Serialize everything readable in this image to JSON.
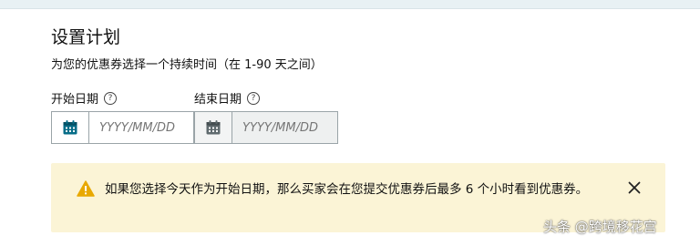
{
  "header": {
    "title": "设置计划",
    "subtitle": "为您的优惠券选择一个持续时间（在 1-90 天之间）"
  },
  "start_date": {
    "label": "开始日期",
    "placeholder": "YYYY/MM/DD",
    "value": ""
  },
  "end_date": {
    "label": "结束日期",
    "placeholder": "YYYY/MM/DD",
    "value": "",
    "disabled": true
  },
  "alert": {
    "text": "如果您选择今天作为开始日期，那么买家会在您提交优惠券后最多 6 个小时看到优惠券。",
    "icon": "warning-icon",
    "close_icon": "close-icon"
  },
  "help_glyph": "?",
  "watermark": "头条 @跨境移花宫",
  "colors": {
    "accent": "#066d88",
    "warning": "#e8a800",
    "alert_bg": "#fbf4d6"
  }
}
